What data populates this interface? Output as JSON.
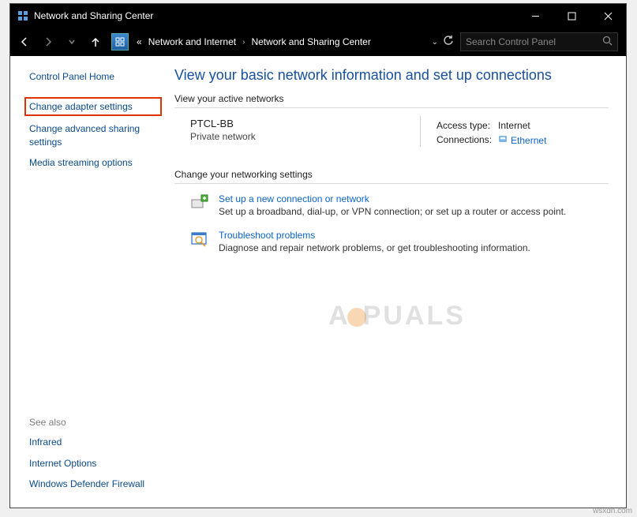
{
  "window": {
    "title": "Network and Sharing Center"
  },
  "breadcrumb": {
    "dots": "«",
    "item1": "Network and Internet",
    "item2": "Network and Sharing Center"
  },
  "search": {
    "placeholder": "Search Control Panel"
  },
  "sidebar": {
    "home": "Control Panel Home",
    "change_adapter": "Change adapter settings",
    "change_advanced": "Change advanced sharing settings",
    "media": "Media streaming options",
    "see_also": "See also",
    "infrared": "Infrared",
    "internet_options": "Internet Options",
    "firewall": "Windows Defender Firewall"
  },
  "main": {
    "heading": "View your basic network information and set up connections",
    "active_networks_title": "View your active networks",
    "network": {
      "name": "PTCL-BB",
      "type": "Private network",
      "access_label": "Access type:",
      "access_value": "Internet",
      "connections_label": "Connections:",
      "connections_value": "Ethernet"
    },
    "change_settings_title": "Change your networking settings",
    "setup": {
      "title": "Set up a new connection or network",
      "desc": "Set up a broadband, dial-up, or VPN connection; or set up a router or access point."
    },
    "troubleshoot": {
      "title": "Troubleshoot problems",
      "desc": "Diagnose and repair network problems, or get troubleshooting information."
    }
  },
  "watermark": "A   PUALS",
  "sourcetag": "wsxdn.com"
}
